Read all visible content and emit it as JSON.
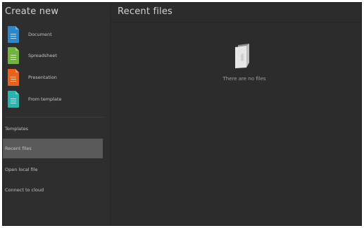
{
  "sidebar": {
    "title": "Create new",
    "create_items": [
      {
        "label": "Document",
        "icon": "document-icon",
        "color": "#2d86c9"
      },
      {
        "label": "Spreadsheet",
        "icon": "spreadsheet-icon",
        "color": "#6fb43f"
      },
      {
        "label": "Presentation",
        "icon": "presentation-icon",
        "color": "#e8621e"
      },
      {
        "label": "From template",
        "icon": "template-icon",
        "color": "#2bb3ad"
      }
    ],
    "nav_items": [
      {
        "label": "Templates",
        "selected": false
      },
      {
        "label": "Recent files",
        "selected": true
      },
      {
        "label": "Open local file",
        "selected": false
      },
      {
        "label": "Connect to cloud",
        "selected": false
      }
    ]
  },
  "main": {
    "title": "Recent files",
    "empty_icon": "empty-files-icon",
    "empty_message": "There are no files"
  }
}
